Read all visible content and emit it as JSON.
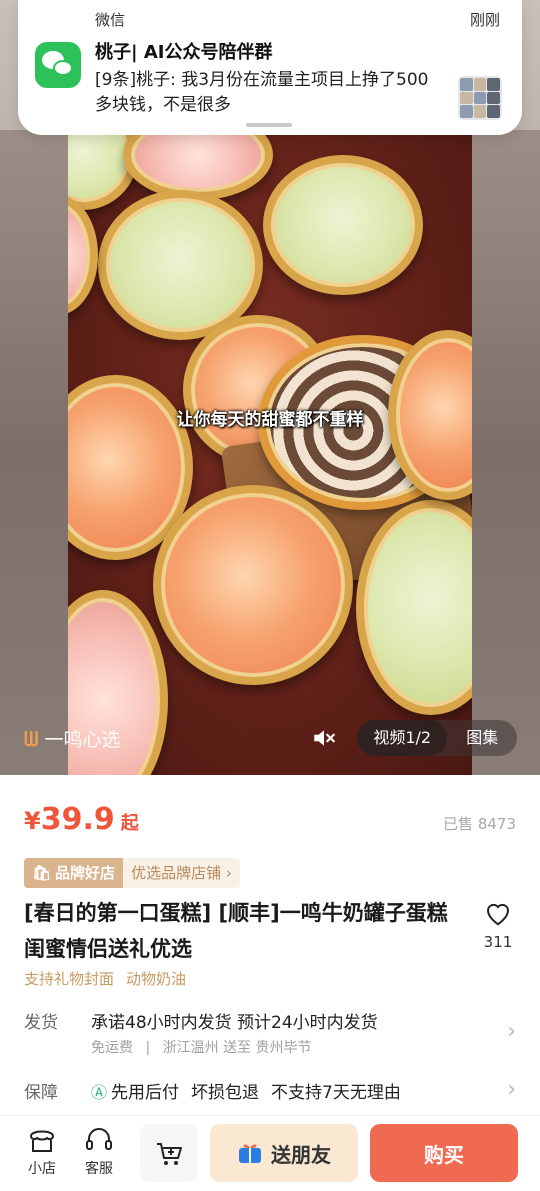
{
  "notification": {
    "app": "微信",
    "time": "刚刚",
    "title": "桃子| AI公众号陪伴群",
    "message": "[9条]桃子: 我3月份在流量主项目上挣了500多块钱，不是很多",
    "icon": "wechat-icon"
  },
  "media": {
    "subtitle": "让你每天的甜蜜都不重样",
    "watermark": "一鸣心选",
    "tabs": [
      "视频1/2",
      "图集"
    ],
    "active_tab": "视频1/2"
  },
  "product": {
    "currency": "¥",
    "price": "39.9",
    "price_suffix": "起",
    "sold": "已售 8473",
    "brand_badge": "品牌好店",
    "brand_store": "优选品牌店铺 ›",
    "title": "[春日的第一口蛋糕] [顺丰]一鸣牛奶罐子蛋糕 闺蜜情侣送礼优选",
    "favorites": "311",
    "tags": [
      "支持礼物封面",
      "动物奶油"
    ]
  },
  "shipping": {
    "label": "发货",
    "main": "承诺48小时内发货  预计24小时内发货",
    "free_shipping": "免运费",
    "route": "浙江温州 送至 贵州毕节"
  },
  "guarantee": {
    "label": "保障",
    "items": [
      "先用后付",
      "坏损包退",
      "不支持7天无理由"
    ]
  },
  "bottom_bar": {
    "shop": "小店",
    "service": "客服",
    "share": "送朋友",
    "buy": "购买"
  },
  "colors": {
    "accent": "#f0553a",
    "buy_button": "#f06a52",
    "share_button": "#fbe8d3",
    "brand_gold": "#d9b48c",
    "wechat_green": "#2dc15a"
  }
}
